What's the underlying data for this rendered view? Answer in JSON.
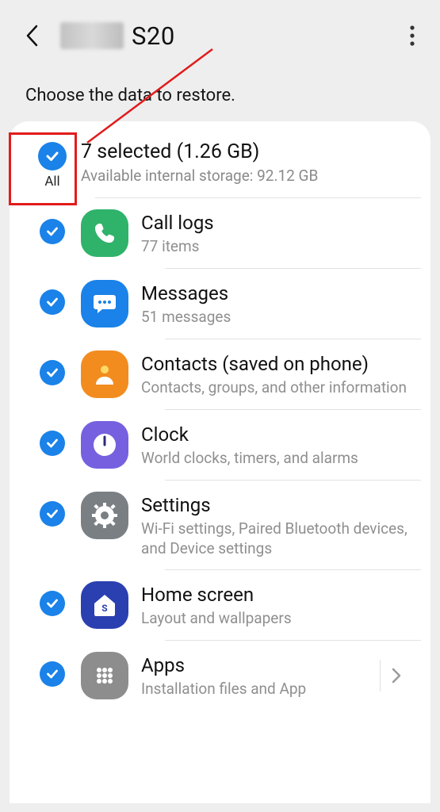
{
  "header": {
    "device_suffix": "S20"
  },
  "subtitle": "Choose the data to restore.",
  "summary": {
    "all_label": "All",
    "title": "7 selected (1.26 GB)",
    "storage": "Available internal storage: 92.12 GB"
  },
  "items": [
    {
      "id": "call-logs",
      "title": "Call logs",
      "sub": "77 items",
      "icon": "phone",
      "bg": "#2fb36a"
    },
    {
      "id": "messages",
      "title": "Messages",
      "sub": "51 messages",
      "icon": "chat",
      "bg": "#1a82e8"
    },
    {
      "id": "contacts",
      "title": "Contacts (saved on phone)",
      "sub": "Contacts, groups, and other information",
      "icon": "person",
      "bg": "#f28c1f"
    },
    {
      "id": "clock",
      "title": "Clock",
      "sub": "World clocks, timers, and alarms",
      "icon": "clock",
      "bg": "#7660e0"
    },
    {
      "id": "settings",
      "title": "Settings",
      "sub": "Wi-Fi settings, Paired Bluetooth devices, and Device settings",
      "icon": "gear",
      "bg": "#7a7f84"
    },
    {
      "id": "home",
      "title": "Home screen",
      "sub": "Layout and wallpapers",
      "icon": "home",
      "bg": "#2a3fb0"
    },
    {
      "id": "apps",
      "title": "Apps",
      "sub": "Installation files and App",
      "icon": "grid",
      "bg": "#8d8d8d"
    }
  ]
}
